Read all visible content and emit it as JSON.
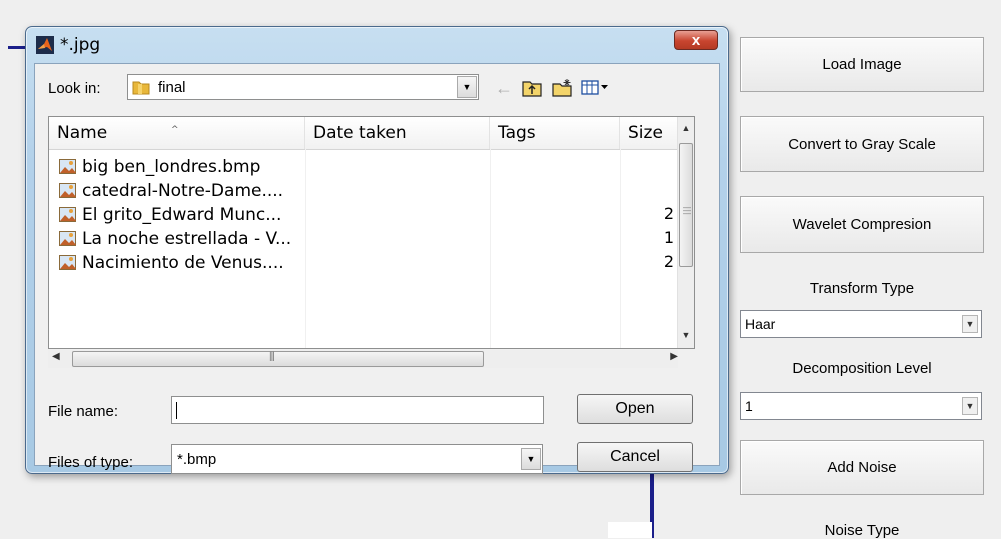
{
  "dialog": {
    "title": "*.jpg",
    "close_symbol": "x",
    "look_in_label": "Look in:",
    "look_in_value": "final",
    "toolbar_icons": [
      "back-arrow-icon",
      "up-folder-icon",
      "new-folder-icon",
      "view-menu-icon"
    ],
    "columns": [
      "Name",
      "Date taken",
      "Tags",
      "Size"
    ],
    "files": [
      {
        "name": "big ben_londres.bmp",
        "size_fragment": ""
      },
      {
        "name": "catedral-Notre-Dame....",
        "size_fragment": ""
      },
      {
        "name": "El grito_Edward Munc...",
        "size_fragment": "2"
      },
      {
        "name": "La noche estrellada - V...",
        "size_fragment": "1"
      },
      {
        "name": "Nacimiento de Venus....",
        "size_fragment": "2"
      }
    ],
    "file_name_label": "File name:",
    "file_name_value": "",
    "files_of_type_label": "Files of type:",
    "files_of_type_value": "*.bmp",
    "open_label": "Open",
    "cancel_label": "Cancel"
  },
  "panel": {
    "load_image": "Load Image",
    "convert_gray": "Convert to Gray Scale",
    "wavelet": "Wavelet Compresion",
    "transform_type_label": "Transform Type",
    "transform_type_value": "Haar",
    "decomposition_label": "Decomposition Level",
    "decomposition_value": "1",
    "add_noise": "Add Noise",
    "noise_type_label": "Noise Type"
  }
}
